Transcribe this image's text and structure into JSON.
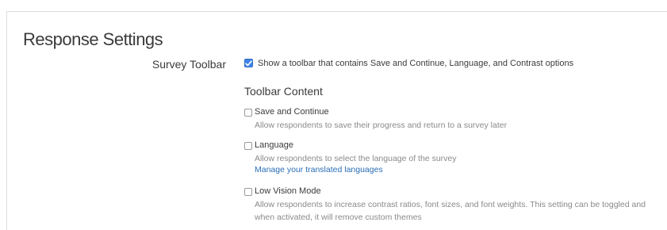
{
  "settings": {
    "title": "Response Settings",
    "survey_toolbar": {
      "label": "Survey Toolbar",
      "checked": true,
      "checkbox_text": "Show a toolbar that contains Save and Continue, Language, and Contrast options"
    },
    "toolbar_content": {
      "heading": "Toolbar Content",
      "options": [
        {
          "label": "Save and Continue",
          "checked": false,
          "description": "Allow respondents to save their progress and return to a survey later"
        },
        {
          "label": "Language",
          "checked": false,
          "description": "Allow respondents to select the language of the survey",
          "link": "Manage your translated languages"
        },
        {
          "label": "Low Vision Mode",
          "checked": false,
          "description": "Allow respondents to increase contrast ratios, font sizes, and font weights. This setting can be toggled and when activated, it will remove custom themes"
        }
      ]
    }
  },
  "colors": {
    "accent": "#3f84e5",
    "link": "#2a6db5",
    "text": "#3b3b3b",
    "muted": "#8a8a8a"
  }
}
